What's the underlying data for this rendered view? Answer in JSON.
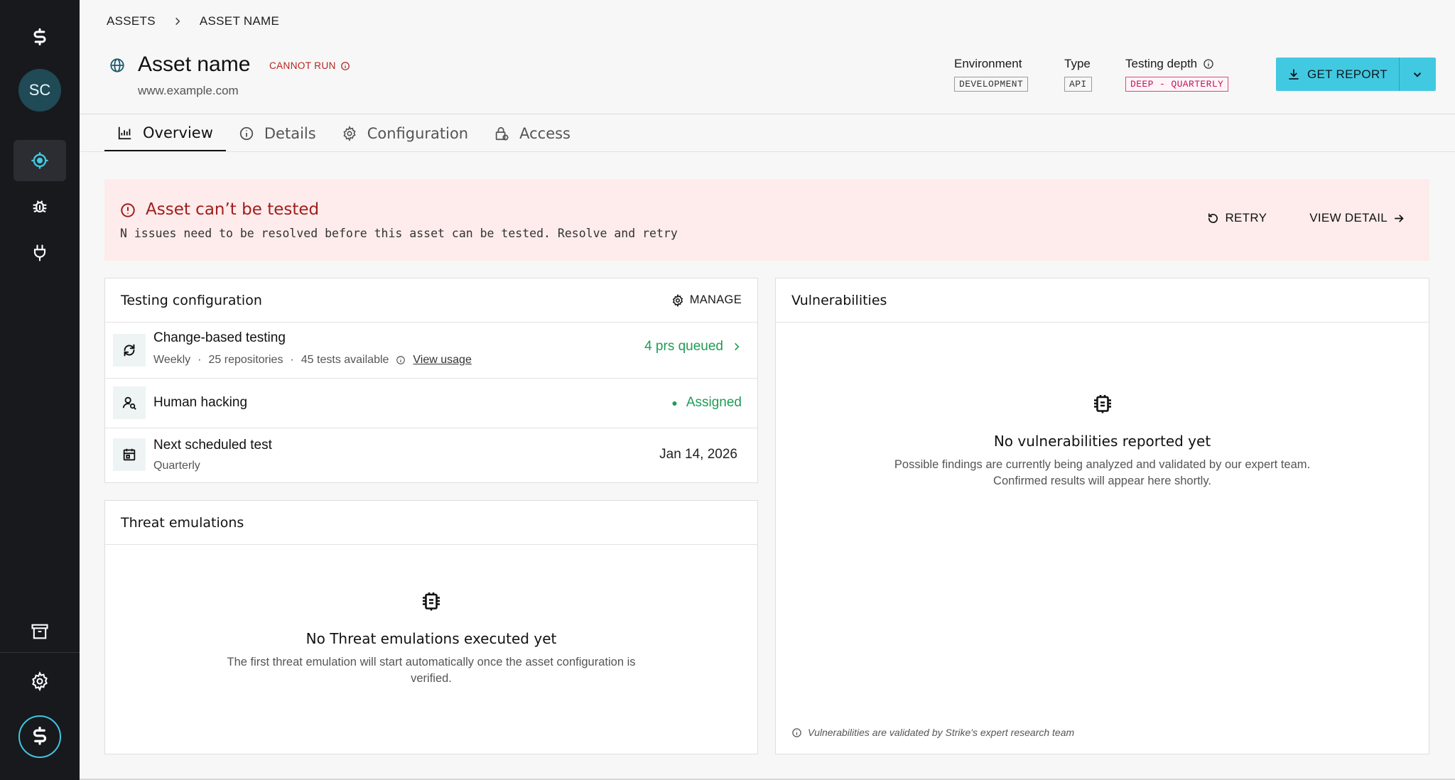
{
  "sidebar": {
    "avatar_initials": "SC",
    "nav": [
      "logo-icon",
      "target-icon",
      "bug-icon",
      "plug-icon",
      "archive-icon",
      "gear-icon",
      "brand-icon"
    ]
  },
  "breadcrumb": {
    "root": "ASSETS",
    "current": "ASSET NAME"
  },
  "asset": {
    "title": "Asset name",
    "status": "CANNOT RUN",
    "url": "www.example.com"
  },
  "meta": {
    "environment_label": "Environment",
    "environment_value": "DEVELOPMENT",
    "type_label": "Type",
    "type_value": "API",
    "depth_label": "Testing depth",
    "depth_value": "DEEP - QUARTERLY"
  },
  "actions": {
    "get_report": "GET REPORT"
  },
  "tabs": [
    {
      "label": "Overview",
      "icon": "chart-icon",
      "active": true
    },
    {
      "label": "Details",
      "icon": "info-icon"
    },
    {
      "label": "Configuration",
      "icon": "gear-icon"
    },
    {
      "label": "Access",
      "icon": "lock-icon"
    }
  ],
  "alert": {
    "title": "Asset can’t be tested",
    "description": "N issues need to be resolved before this asset can be tested. Resolve and retry",
    "retry": "RETRY",
    "view_detail": "VIEW DETAIL"
  },
  "testing_config": {
    "title": "Testing configuration",
    "manage": "MANAGE",
    "rows": [
      {
        "name": "Change-based testing",
        "sub_frequency": "Weekly",
        "sub_repos": "25 repositories",
        "sub_tests": "45 tests available",
        "sub_link": "View usage",
        "right": "4 prs queued"
      },
      {
        "name": "Human hacking",
        "right": "Assigned"
      },
      {
        "name": "Next scheduled test",
        "sub": "Quarterly",
        "right": "Jan 14, 2026"
      }
    ]
  },
  "threats": {
    "title": "Threat emulations",
    "empty_title": "No Threat emulations executed yet",
    "empty_desc": "The first threat emulation will start automatically once the asset configuration is verified."
  },
  "vulns": {
    "title": "Vulnerabilities",
    "empty_title": "No vulnerabilities reported yet",
    "empty_desc": "Possible findings are currently being analyzed and validated by our expert team. Confirmed results will appear here shortly.",
    "footnote": "Vulnerabilities are validated by Strike's expert research team"
  },
  "colors": {
    "accent": "#42c9e2",
    "danger": "#a11d1d",
    "success": "#1f9d55",
    "sidebar": "#18191d"
  }
}
